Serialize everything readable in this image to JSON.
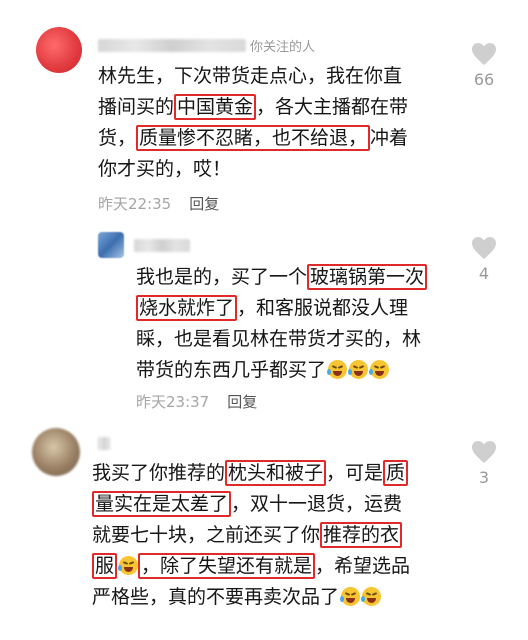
{
  "icons": {
    "like": "heart-outline-icon",
    "emoji": "loudly-crying-face-icon"
  },
  "colors": {
    "highlight": "#e02a2a",
    "meta": "#a5a5a5",
    "text": "#161616"
  },
  "comments": [
    {
      "tag": "你关注的人",
      "likes": "66",
      "time": "昨天22:35",
      "reply": "回复",
      "lines": [
        [
          {
            "t": "林先生，下次带货走点心，我在你直"
          }
        ],
        [
          {
            "t": "播间买的"
          },
          {
            "t": "中国黄金",
            "hl": true
          },
          {
            "t": "，各大主播都在带"
          }
        ],
        [
          {
            "t": "货，"
          },
          {
            "t": "质量惨不忍睹，也不给退，",
            "hl": true
          },
          {
            "t": "冲着"
          }
        ],
        [
          {
            "t": "你才买的，哎！"
          }
        ]
      ]
    },
    {
      "tag": "",
      "likes": "4",
      "time": "昨天23:37",
      "reply": "回复",
      "lines": [
        [
          {
            "t": "我也是的，买了一个"
          },
          {
            "t": "玻璃锅第一次",
            "hl": true
          }
        ],
        [
          {
            "t": "烧水就炸了",
            "hl": true
          },
          {
            "t": "，和客服说都没人理"
          }
        ],
        [
          {
            "t": "睬，也是看见林在带货才买的，林"
          }
        ],
        [
          {
            "t": "带货的东西几乎都买了"
          },
          {
            "emoji": 3
          }
        ]
      ]
    },
    {
      "tag": "",
      "likes": "3",
      "time": "",
      "reply": "",
      "lines": [
        [
          {
            "t": "我买了你推荐的"
          },
          {
            "t": "枕头和被子",
            "hl": true
          },
          {
            "t": "，可是"
          },
          {
            "t": "质",
            "hl": true
          }
        ],
        [
          {
            "t": "量实在是太差了",
            "hl": true
          },
          {
            "t": "，双十一退货，运费"
          }
        ],
        [
          {
            "t": "就要七十块，之前还买了你"
          },
          {
            "t": "推荐的衣",
            "hl": true
          }
        ],
        [
          {
            "t": "服",
            "hl": true
          },
          {
            "emoji": 1
          },
          {
            "t": "，除了失望还有就是",
            "hl": true
          },
          {
            "t": "，希望选品"
          }
        ],
        [
          {
            "t": "严格些，真的不要再卖次品了"
          },
          {
            "emoji": 2
          }
        ]
      ]
    }
  ]
}
